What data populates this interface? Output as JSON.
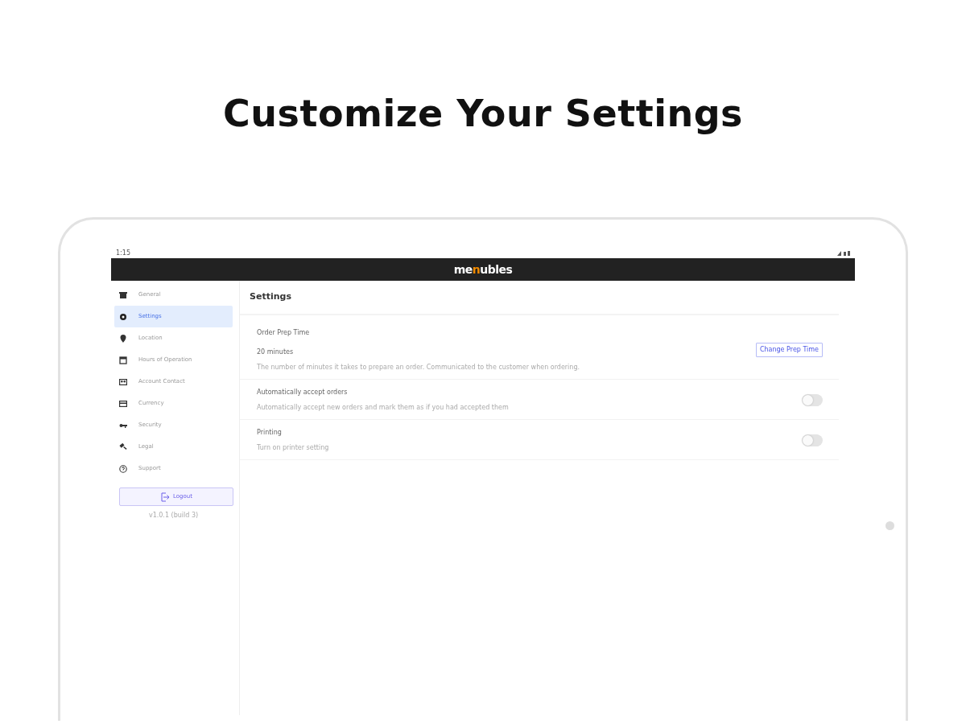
{
  "headline": "Customize Your Settings",
  "status_bar": {
    "time": "1:15"
  },
  "app_bar": {
    "logo": {
      "before": "me",
      "accent": "n",
      "after": "ubles"
    }
  },
  "sidebar": {
    "items": [
      {
        "label": "General",
        "selected": false
      },
      {
        "label": "Settings",
        "selected": true
      },
      {
        "label": "Location",
        "selected": false
      },
      {
        "label": "Hours of Operation",
        "selected": false
      },
      {
        "label": "Account Contact",
        "selected": false
      },
      {
        "label": "Currency",
        "selected": false
      },
      {
        "label": "Security",
        "selected": false
      },
      {
        "label": "Legal",
        "selected": false
      },
      {
        "label": "Support",
        "selected": false
      }
    ],
    "logout": "Logout",
    "version": "v1.0.1 (build 3)"
  },
  "page_title": "Settings",
  "settings": [
    {
      "kind": "button",
      "title": "Order Prep Time",
      "value": "20 minutes",
      "description": "The number of minutes it takes to prepare an order. Communicated to the customer when ordering.",
      "button": "Change Prep Time"
    },
    {
      "kind": "toggle",
      "title": "Automatically accept orders",
      "description": "Automatically accept new orders and mark them as if you had accepted them",
      "on": false
    },
    {
      "kind": "toggle",
      "title": "Printing",
      "description": "Turn on printer setting",
      "on": false
    }
  ]
}
